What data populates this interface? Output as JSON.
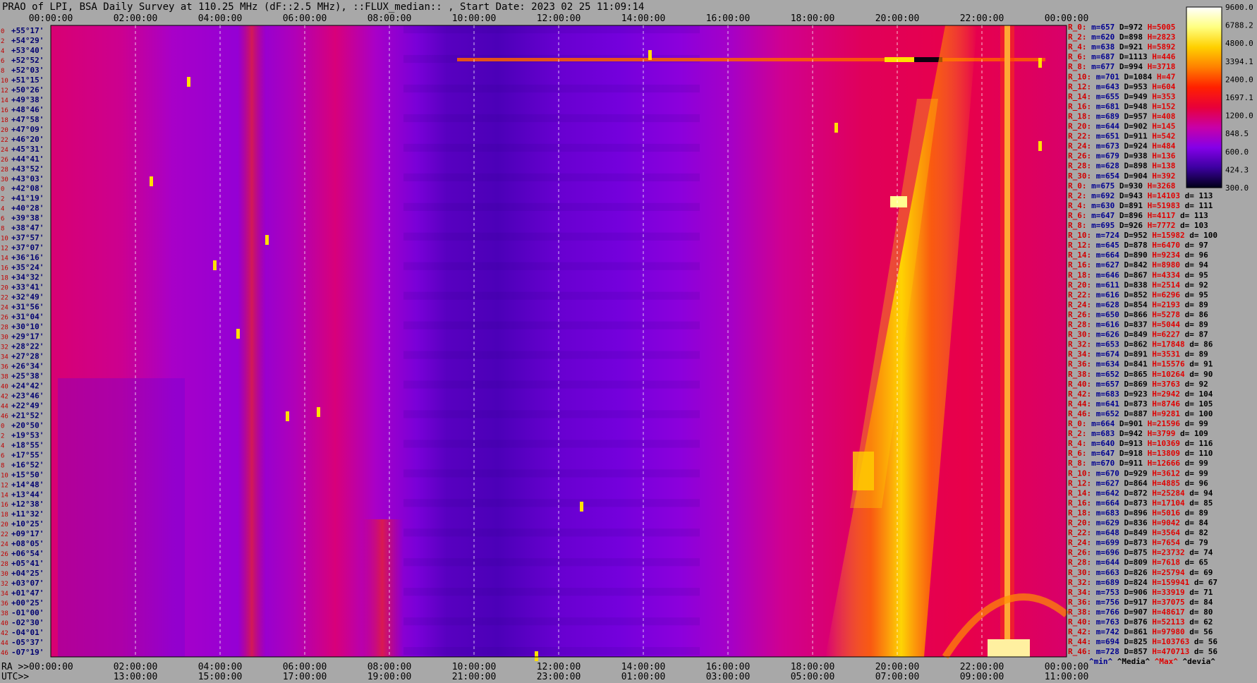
{
  "title": "PRAO of LPI, BSA Daily Survey at 110.25 MHz (dF::2.5 MHz), ::FLUX_median:: , Start Date: 2023 02 25 11:09:14",
  "chart_data": {
    "type": "heatmap",
    "title": "PRAO of LPI, BSA Daily Survey at 110.25 MHz (dF::2.5 MHz), ::FLUX_median:: , Start Date: 2023 02 25 11:09:14",
    "x_top_ticks": [
      "00:00:00",
      "02:00:00",
      "04:00:00",
      "06:00:00",
      "08:00:00",
      "10:00:00",
      "12:00:00",
      "14:00:00",
      "16:00:00",
      "18:00:00",
      "20:00:00",
      "22:00:00",
      "00:00:00"
    ],
    "x_bottom_ra_ticks": [
      "RA >>00:00:00",
      "02:00:00",
      "04:00:00",
      "06:00:00",
      "08:00:00",
      "10:00:00",
      "12:00:00",
      "14:00:00",
      "16:00:00",
      "18:00:00",
      "20:00:00",
      "22:00:00",
      "00:00:00"
    ],
    "x_bottom_utc_ticks": [
      "UTC>>",
      "13:00:00",
      "15:00:00",
      "17:00:00",
      "19:00:00",
      "21:00:00",
      "23:00:00",
      "01:00:00",
      "03:00:00",
      "05:00:00",
      "07:00:00",
      "09:00:00",
      "11:00:00"
    ],
    "ra_range_hours": [
      0,
      24
    ],
    "dec_labels": [
      "+55°17'",
      "+54°29'",
      "+53°40'",
      "+52°52'",
      "+52°03'",
      "+51°15'",
      "+50°26'",
      "+49°38'",
      "+48°46'",
      "+47°58'",
      "+47°09'",
      "+46°20'",
      "+45°31'",
      "+44°41'",
      "+43°52'",
      "+43°03'",
      "+42°08'",
      "+41°19'",
      "+40°28'",
      "+39°38'",
      "+38°47'",
      "+37°57'",
      "+37°07'",
      "+36°16'",
      "+35°24'",
      "+34°32'",
      "+33°41'",
      "+32°49'",
      "+31°56'",
      "+31°04'",
      "+30°10'",
      "+29°17'",
      "+28°22'",
      "+27°28'",
      "+26°34'",
      "+25°38'",
      "+24°42'",
      "+23°46'",
      "+22°49'",
      "+21°52'",
      "+20°50'",
      "+19°53'",
      "+18°55'",
      "+17°55'",
      "+16°52'",
      "+15°50'",
      "+14°48'",
      "+13°44'",
      "+12°38'",
      "+11°32'",
      "+10°25'",
      "+09°17'",
      "+08°05'",
      "+06°54'",
      "+05°41'",
      "+04°25'",
      "+03°07'",
      "+01°47'",
      "+00°25'",
      "-01°00'",
      "-02°30'",
      "-04°01'",
      "-05°37'",
      "-07°19'"
    ],
    "row_index_labels": [
      "0",
      "2",
      "4",
      "6",
      "8",
      "10",
      "12",
      "14",
      "16",
      "18",
      "20",
      "22",
      "24",
      "26",
      "28",
      "30",
      "0",
      "2",
      "4",
      "6",
      "8",
      "10",
      "12",
      "14",
      "16",
      "18",
      "20",
      "22",
      "24",
      "26",
      "28",
      "30",
      "32",
      "34",
      "36",
      "38",
      "40",
      "42",
      "44",
      "46",
      "0",
      "2",
      "4",
      "6",
      "8",
      "10",
      "12",
      "14",
      "16",
      "18",
      "20",
      "22",
      "24",
      "26",
      "28",
      "30",
      "32",
      "34",
      "36",
      "38",
      "40",
      "42",
      "44",
      "46"
    ],
    "colorbar": {
      "ticks": [
        "9600.0",
        "6788.2",
        "4800.0",
        "3394.1",
        "2400.0",
        "1697.1",
        "1200.0",
        "848.5",
        "600.0",
        "424.3",
        "300.0"
      ],
      "colors": [
        "#ffffff",
        "#ffff80",
        "#ffd000",
        "#ff8000",
        "#ff2000",
        "#e8003a",
        "#c800a8",
        "#8400e8",
        "#3c00a0",
        "#000018"
      ]
    },
    "stats_rows": [
      {
        "r": "R_0:",
        "m": "m=657",
        "d": "D=972",
        "h": "H=5005",
        "dev": ""
      },
      {
        "r": "R_2:",
        "m": "m=620",
        "d": "D=898",
        "h": "H=2823",
        "dev": ""
      },
      {
        "r": "R_4:",
        "m": "m=638",
        "d": "D=921",
        "h": "H=5892",
        "dev": ""
      },
      {
        "r": "R_6:",
        "m": "m=687",
        "d": "D=1113",
        "h": "H=446",
        "dev": ""
      },
      {
        "r": "R_8:",
        "m": "m=677",
        "d": "D=994",
        "h": "H=3718",
        "dev": ""
      },
      {
        "r": "R_10:",
        "m": "m=701",
        "d": "D=1084",
        "h": "H=47",
        "dev": ""
      },
      {
        "r": "R_12:",
        "m": "m=643",
        "d": "D=953",
        "h": "H=604",
        "dev": ""
      },
      {
        "r": "R_14:",
        "m": "m=655",
        "d": "D=949",
        "h": "H=353",
        "dev": ""
      },
      {
        "r": "R_16:",
        "m": "m=681",
        "d": "D=948",
        "h": "H=152",
        "dev": ""
      },
      {
        "r": "R_18:",
        "m": "m=689",
        "d": "D=957",
        "h": "H=408",
        "dev": ""
      },
      {
        "r": "R_20:",
        "m": "m=644",
        "d": "D=902",
        "h": "H=145",
        "dev": ""
      },
      {
        "r": "R_22:",
        "m": "m=651",
        "d": "D=911",
        "h": "H=542",
        "dev": ""
      },
      {
        "r": "R_24:",
        "m": "m=673",
        "d": "D=924",
        "h": "H=484",
        "dev": ""
      },
      {
        "r": "R_26:",
        "m": "m=679",
        "d": "D=938",
        "h": "H=136",
        "dev": ""
      },
      {
        "r": "R_28:",
        "m": "m=628",
        "d": "D=898",
        "h": "H=138",
        "dev": ""
      },
      {
        "r": "R_30:",
        "m": "m=654",
        "d": "D=904",
        "h": "H=392",
        "dev": ""
      },
      {
        "r": "R_0:",
        "m": "m=675",
        "d": "D=930",
        "h": "H=3268",
        "dev": ""
      },
      {
        "r": "R_2:",
        "m": "m=692",
        "d": "D=943",
        "h": "H=14103",
        "dev": "d= 113"
      },
      {
        "r": "R_4:",
        "m": "m=630",
        "d": "D=891",
        "h": "H=51983",
        "dev": "d= 111"
      },
      {
        "r": "R_6:",
        "m": "m=647",
        "d": "D=896",
        "h": "H=4117",
        "dev": "d= 113"
      },
      {
        "r": "R_8:",
        "m": "m=695",
        "d": "D=926",
        "h": "H=7772",
        "dev": "d= 103"
      },
      {
        "r": "R_10:",
        "m": "m=724",
        "d": "D=952",
        "h": "H=15982",
        "dev": "d= 100"
      },
      {
        "r": "R_12:",
        "m": "m=645",
        "d": "D=878",
        "h": "H=6470",
        "dev": "d= 97"
      },
      {
        "r": "R_14:",
        "m": "m=664",
        "d": "D=890",
        "h": "H=9234",
        "dev": "d= 96"
      },
      {
        "r": "R_16:",
        "m": "m=627",
        "d": "D=842",
        "h": "H=8980",
        "dev": "d= 94"
      },
      {
        "r": "R_18:",
        "m": "m=646",
        "d": "D=867",
        "h": "H=4334",
        "dev": "d= 95"
      },
      {
        "r": "R_20:",
        "m": "m=611",
        "d": "D=838",
        "h": "H=2514",
        "dev": "d= 92"
      },
      {
        "r": "R_22:",
        "m": "m=616",
        "d": "D=852",
        "h": "H=6296",
        "dev": "d= 95"
      },
      {
        "r": "R_24:",
        "m": "m=628",
        "d": "D=854",
        "h": "H=2193",
        "dev": "d= 89"
      },
      {
        "r": "R_26:",
        "m": "m=650",
        "d": "D=866",
        "h": "H=5278",
        "dev": "d= 86"
      },
      {
        "r": "R_28:",
        "m": "m=616",
        "d": "D=837",
        "h": "H=5044",
        "dev": "d= 89"
      },
      {
        "r": "R_30:",
        "m": "m=626",
        "d": "D=849",
        "h": "H=6227",
        "dev": "d= 87"
      },
      {
        "r": "R_32:",
        "m": "m=653",
        "d": "D=862",
        "h": "H=17848",
        "dev": "d= 86"
      },
      {
        "r": "R_34:",
        "m": "m=674",
        "d": "D=891",
        "h": "H=3531",
        "dev": "d= 89"
      },
      {
        "r": "R_36:",
        "m": "m=634",
        "d": "D=841",
        "h": "H=15576",
        "dev": "d= 91"
      },
      {
        "r": "R_38:",
        "m": "m=652",
        "d": "D=865",
        "h": "H=10264",
        "dev": "d= 90"
      },
      {
        "r": "R_40:",
        "m": "m=657",
        "d": "D=869",
        "h": "H=3763",
        "dev": "d= 92"
      },
      {
        "r": "R_42:",
        "m": "m=683",
        "d": "D=923",
        "h": "H=2942",
        "dev": "d= 104"
      },
      {
        "r": "R_44:",
        "m": "m=641",
        "d": "D=873",
        "h": "H=8746",
        "dev": "d= 105"
      },
      {
        "r": "R_46:",
        "m": "m=652",
        "d": "D=887",
        "h": "H=9281",
        "dev": "d= 100"
      },
      {
        "r": "R_0:",
        "m": "m=664",
        "d": "D=901",
        "h": "H=21596",
        "dev": "d= 99"
      },
      {
        "r": "R_2:",
        "m": "m=683",
        "d": "D=942",
        "h": "H=3799",
        "dev": "d= 109"
      },
      {
        "r": "R_4:",
        "m": "m=640",
        "d": "D=913",
        "h": "H=10369",
        "dev": "d= 116"
      },
      {
        "r": "R_6:",
        "m": "m=647",
        "d": "D=918",
        "h": "H=13809",
        "dev": "d= 110"
      },
      {
        "r": "R_8:",
        "m": "m=670",
        "d": "D=911",
        "h": "H=12666",
        "dev": "d= 99"
      },
      {
        "r": "R_10:",
        "m": "m=670",
        "d": "D=929",
        "h": "H=3612",
        "dev": "d= 99"
      },
      {
        "r": "R_12:",
        "m": "m=627",
        "d": "D=864",
        "h": "H=4885",
        "dev": "d= 96"
      },
      {
        "r": "R_14:",
        "m": "m=642",
        "d": "D=872",
        "h": "H=25284",
        "dev": "d= 94"
      },
      {
        "r": "R_16:",
        "m": "m=664",
        "d": "D=873",
        "h": "H=17104",
        "dev": "d= 85"
      },
      {
        "r": "R_18:",
        "m": "m=683",
        "d": "D=896",
        "h": "H=5016",
        "dev": "d= 89"
      },
      {
        "r": "R_20:",
        "m": "m=629",
        "d": "D=836",
        "h": "H=9042",
        "dev": "d= 84"
      },
      {
        "r": "R_22:",
        "m": "m=648",
        "d": "D=849",
        "h": "H=3564",
        "dev": "d= 82"
      },
      {
        "r": "R_24:",
        "m": "m=699",
        "d": "D=873",
        "h": "H=7654",
        "dev": "d= 79"
      },
      {
        "r": "R_26:",
        "m": "m=696",
        "d": "D=875",
        "h": "H=23732",
        "dev": "d= 74"
      },
      {
        "r": "R_28:",
        "m": "m=644",
        "d": "D=809",
        "h": "H=7618",
        "dev": "d= 65"
      },
      {
        "r": "R_30:",
        "m": "m=663",
        "d": "D=826",
        "h": "H=25794",
        "dev": "d= 69"
      },
      {
        "r": "R_32:",
        "m": "m=689",
        "d": "D=824",
        "h": "H=159941",
        "dev": "d= 67"
      },
      {
        "r": "R_34:",
        "m": "m=753",
        "d": "D=906",
        "h": "H=33919",
        "dev": "d= 71"
      },
      {
        "r": "R_36:",
        "m": "m=756",
        "d": "D=917",
        "h": "H=37075",
        "dev": "d= 84"
      },
      {
        "r": "R_38:",
        "m": "m=766",
        "d": "D=907",
        "h": "H=48617",
        "dev": "d= 80"
      },
      {
        "r": "R_40:",
        "m": "m=763",
        "d": "D=876",
        "h": "H=52113",
        "dev": "d= 62"
      },
      {
        "r": "R_42:",
        "m": "m=742",
        "d": "D=861",
        "h": "H=97980",
        "dev": "d= 56"
      },
      {
        "r": "R_44:",
        "m": "m=694",
        "d": "D=825",
        "h": "H=103763",
        "dev": "d= 56"
      },
      {
        "r": "R_46:",
        "m": "m=728",
        "d": "D=857",
        "h": "H=470713",
        "dev": "d= 56"
      }
    ],
    "stats_footer": [
      "^min^",
      "^Media^",
      "^Max^",
      "^devia^"
    ]
  }
}
